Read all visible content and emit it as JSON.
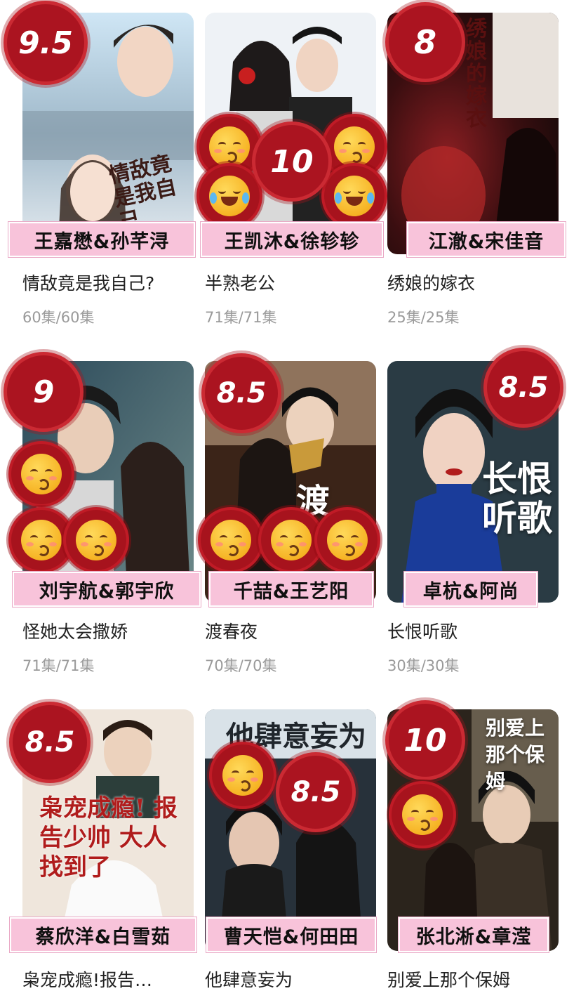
{
  "dramas": [
    {
      "title": "情敌竟是我自己?",
      "episodes": "60集/60集",
      "score": "9.5",
      "cast": "王嘉懋&孙芊浔",
      "poster_text": "情敌竟是我自己"
    },
    {
      "title": "半熟老公",
      "episodes": "71集/71集",
      "score": "10",
      "cast": "王凯沐&徐轸轸",
      "poster_text": ""
    },
    {
      "title": "绣娘的嫁衣",
      "episodes": "25集/25集",
      "score": "8",
      "cast": "江澈&宋佳音",
      "poster_text": "绣娘的嫁衣"
    },
    {
      "title": "怪她太会撒娇",
      "episodes": "71集/71集",
      "score": "9",
      "cast": "刘宇航&郭宇欣",
      "poster_text": ""
    },
    {
      "title": "渡春夜",
      "episodes": "70集/70集",
      "score": "8.5",
      "cast": "千喆&王艺阳",
      "poster_text": "渡"
    },
    {
      "title": "长恨听歌",
      "episodes": "30集/30集",
      "score": "8.5",
      "cast": "卓杭&阿尚",
      "poster_text": "长恨听歌"
    },
    {
      "title": "枭宠成瘾!报告…",
      "episodes": "",
      "score": "8.5",
      "cast": "蔡欣洋&白雪茹",
      "poster_text": "枭宠成瘾! 报告少帅 大人找到了"
    },
    {
      "title": "他肆意妄为",
      "episodes": "",
      "score": "8.5",
      "cast": "曹天恺&何田田",
      "poster_text": "他肆意妄为"
    },
    {
      "title": "别爱上那个保姆",
      "episodes": "",
      "score": "10",
      "cast": "张北淅&章滢",
      "poster_text": "别爱上 那个保姆"
    }
  ],
  "icons": [
    "kissing-face-icon",
    "laughing-tears-face-icon"
  ],
  "colors": {
    "badge": "#a7131d",
    "cast_label": "#f8c3da",
    "episodes": "#9a9a9a"
  }
}
